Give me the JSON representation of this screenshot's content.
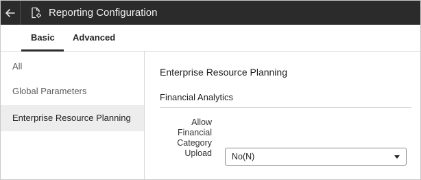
{
  "header": {
    "back_icon": "back-arrow-icon",
    "doc_icon": "document-settings-icon",
    "title": "Reporting Configuration",
    "background": "#2b2b2b"
  },
  "tabs": [
    {
      "label": "Basic",
      "selected": true
    },
    {
      "label": "Advanced",
      "selected": false
    }
  ],
  "sidebar": {
    "items": [
      {
        "label": "All",
        "selected": false
      },
      {
        "label": "Global Parameters",
        "selected": false
      },
      {
        "label": "Enterprise Resource Planning",
        "selected": true
      }
    ]
  },
  "main": {
    "section_title": "Enterprise Resource Planning",
    "subsection_title": "Financial Analytics",
    "field": {
      "label_lines": [
        "Allow",
        "Financial",
        "Category",
        "Upload"
      ],
      "value": "No(N)"
    }
  }
}
